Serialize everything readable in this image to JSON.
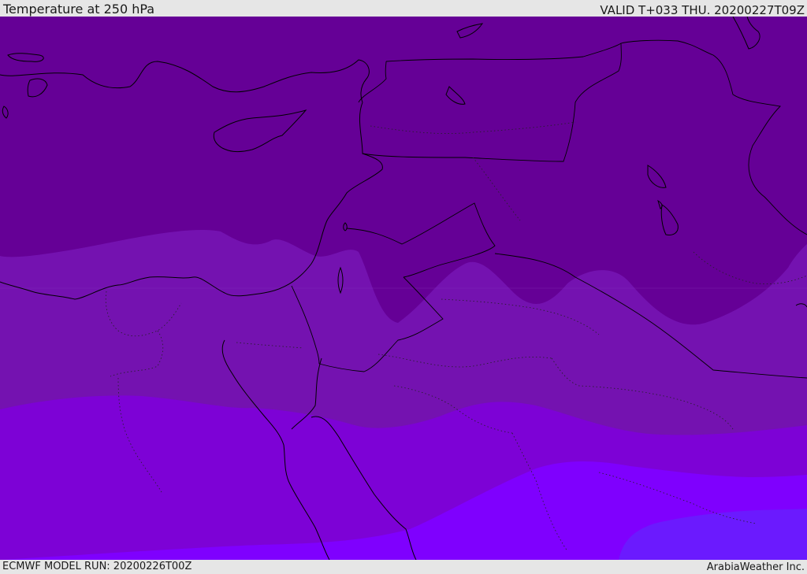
{
  "header": {
    "title": "Temperature at 250 hPa",
    "valid": "VALID T+033 THU. 20200227T09Z"
  },
  "footer": {
    "model_run": "ECMWF MODEL RUN: 20200226T00Z",
    "credit": "ArabiaWeather Inc."
  },
  "map": {
    "bands": [
      {
        "name": "darkest",
        "color": "#650096"
      },
      {
        "name": "dark",
        "color": "#7412b0"
      },
      {
        "name": "medium",
        "color": "#7d02d6"
      },
      {
        "name": "bright",
        "color": "#7f00fe"
      },
      {
        "name": "blue",
        "color": "#6b1afe"
      }
    ],
    "line_color": "#000000"
  }
}
